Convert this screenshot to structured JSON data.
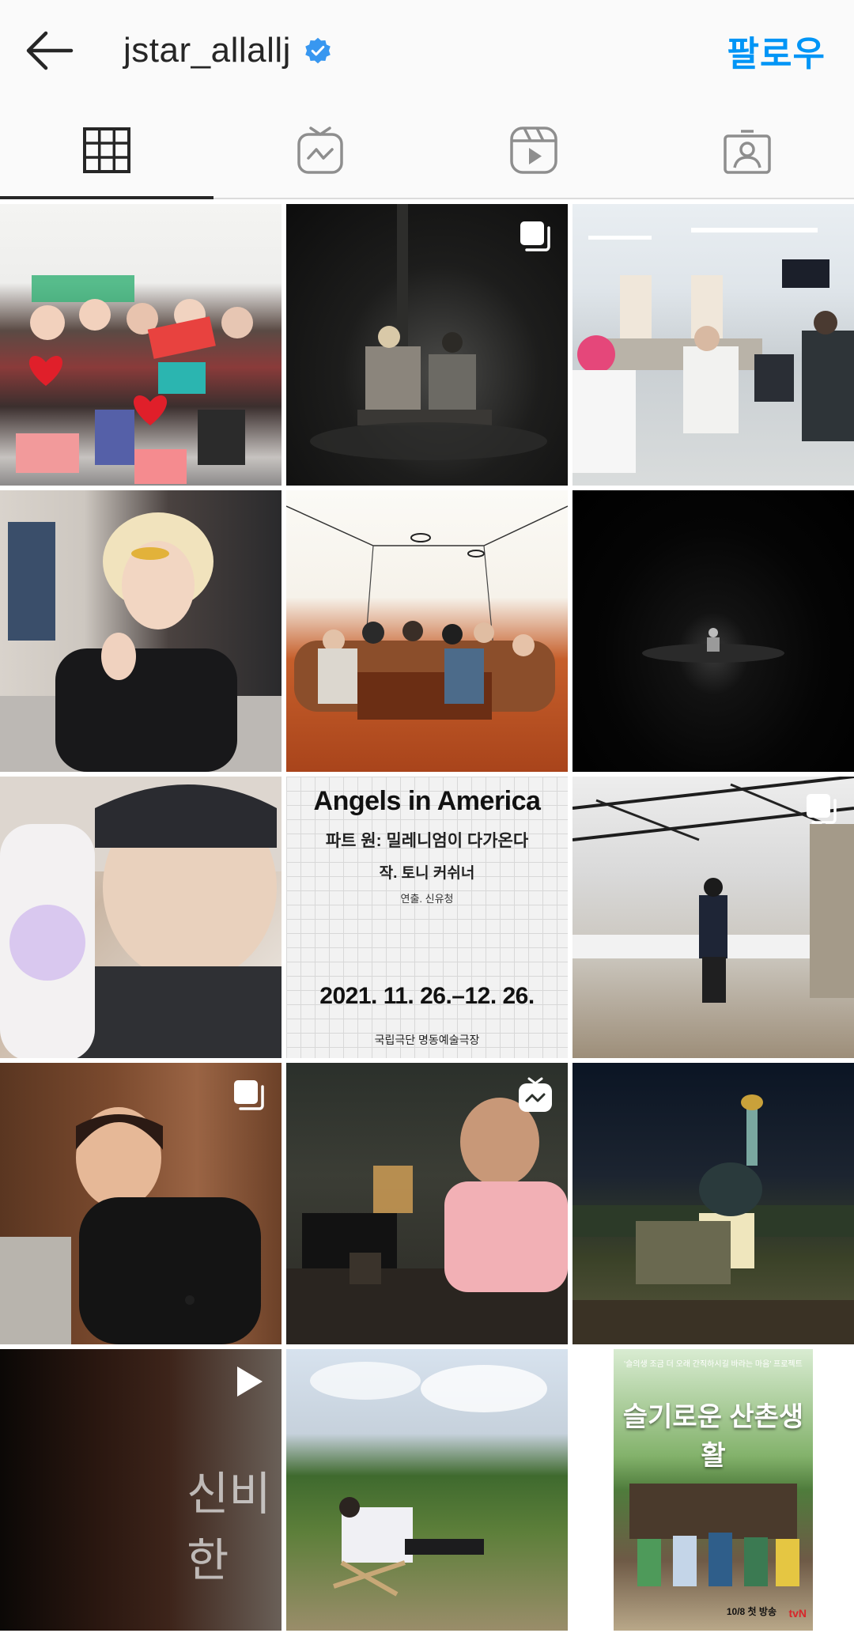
{
  "header": {
    "username": "jstar_allallj",
    "follow_label": "팔로우",
    "accent_color": "#0095f6",
    "back_icon": "arrow-left-icon",
    "verified_icon": "verified-badge-icon"
  },
  "tabs": [
    {
      "name": "posts",
      "icon": "grid-icon",
      "active": true
    },
    {
      "name": "igtv",
      "icon": "igtv-icon",
      "active": false
    },
    {
      "name": "reels",
      "icon": "reels-icon",
      "active": false
    },
    {
      "name": "tagged",
      "icon": "tagged-user-icon",
      "active": false
    }
  ],
  "posts": [
    {
      "badge": null,
      "type": "photo"
    },
    {
      "badge": "carousel-icon",
      "type": "photo"
    },
    {
      "badge": null,
      "type": "photo"
    },
    {
      "badge": null,
      "type": "photo"
    },
    {
      "badge": null,
      "type": "photo"
    },
    {
      "badge": null,
      "type": "photo"
    },
    {
      "badge": null,
      "type": "photo"
    },
    {
      "badge": null,
      "type": "poster"
    },
    {
      "badge": "carousel-icon",
      "type": "photo"
    },
    {
      "badge": "carousel-icon",
      "type": "photo"
    },
    {
      "badge": "igtv-icon",
      "type": "video"
    },
    {
      "badge": null,
      "type": "photo"
    },
    {
      "badge": "play-icon",
      "type": "video"
    },
    {
      "badge": null,
      "type": "photo"
    },
    {
      "badge": null,
      "type": "poster"
    }
  ],
  "poster": {
    "title": "Angels in America",
    "subtitle": "파트 원: 밀레니엄이 다가온다",
    "author": "작. 토니 커쉬너",
    "director": "연출. 신유청",
    "dates": "2021. 11. 26.–12. 26.",
    "venue": "국립극단 명동예술극장"
  },
  "video_text": "신비한",
  "tvn_poster": {
    "subtitle": "'슬의생 조금 더 오래 간직하시길 바라는 마음' 프로젝트",
    "title": "슬기로운 산촌생활",
    "airdate": "10/8 첫 방송",
    "channel": "tvN"
  }
}
